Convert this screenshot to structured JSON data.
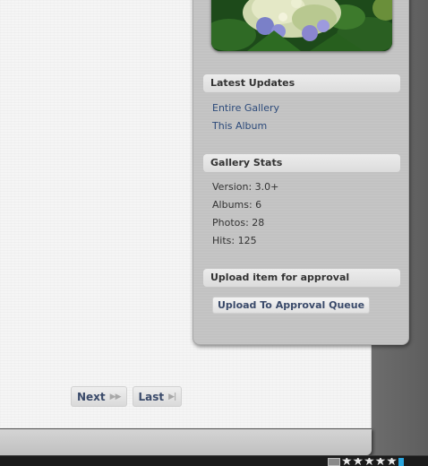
{
  "pager": {
    "next_label": "Next",
    "last_label": "Last",
    "next_arrow": "▶▶",
    "last_arrow": "▶|"
  },
  "sidebar": {
    "latest_updates": {
      "title": "Latest Updates",
      "links": [
        "Entire Gallery",
        "This Album"
      ]
    },
    "gallery_stats": {
      "title": "Gallery Stats",
      "lines": [
        "Version: 3.0+",
        "Albums: 6",
        "Photos: 28",
        "Hits: 125"
      ]
    },
    "upload": {
      "title": "Upload item for approval",
      "button_label": "Upload To Approval Queue"
    }
  },
  "rating": {
    "stars": "★★★★★"
  },
  "colors": {
    "link": "#2c4a7a",
    "button_text": "#3a4a6a",
    "sidebar_bg": "#c2c2c2",
    "accent_blue": "#2aa7e0"
  }
}
